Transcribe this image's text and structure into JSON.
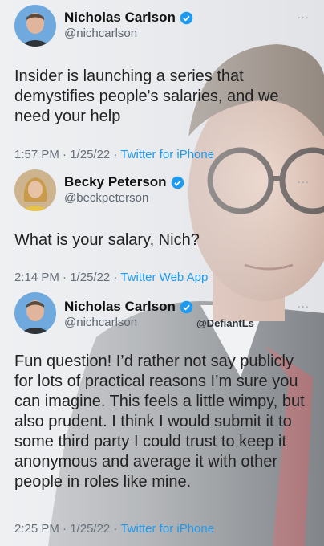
{
  "tweets": [
    {
      "name": "Nicholas Carlson",
      "handle": "@nichcarlson",
      "body": "Insider is launching a series that demystifies people's salaries, and we need your help",
      "time": "1:57 PM",
      "date": "1/25/22",
      "source": "Twitter for iPhone"
    },
    {
      "name": "Becky Peterson",
      "handle": "@beckpeterson",
      "body": "What is your salary, Nich?",
      "time": "2:14 PM",
      "date": "1/25/22",
      "source": "Twitter Web App"
    },
    {
      "name": "Nicholas Carlson",
      "handle": "@nichcarlson",
      "body": "Fun question! I’d rather not say publicly for lots of practical reasons I’m sure you can imagine. This feels a little wimpy, but also prudent. I think I would submit it to some third party I could trust to keep it anonymous and average it with other people in roles like mine.",
      "time": "2:25 PM",
      "date": "1/25/22",
      "source": "Twitter for iPhone"
    }
  ],
  "separator": "·",
  "more_icon": "...",
  "watermark": "@DefiantLs",
  "colors": {
    "link": "#1d9bf0",
    "verified": "#1d9bf0",
    "text": "#222222",
    "muted": "#66707a"
  }
}
